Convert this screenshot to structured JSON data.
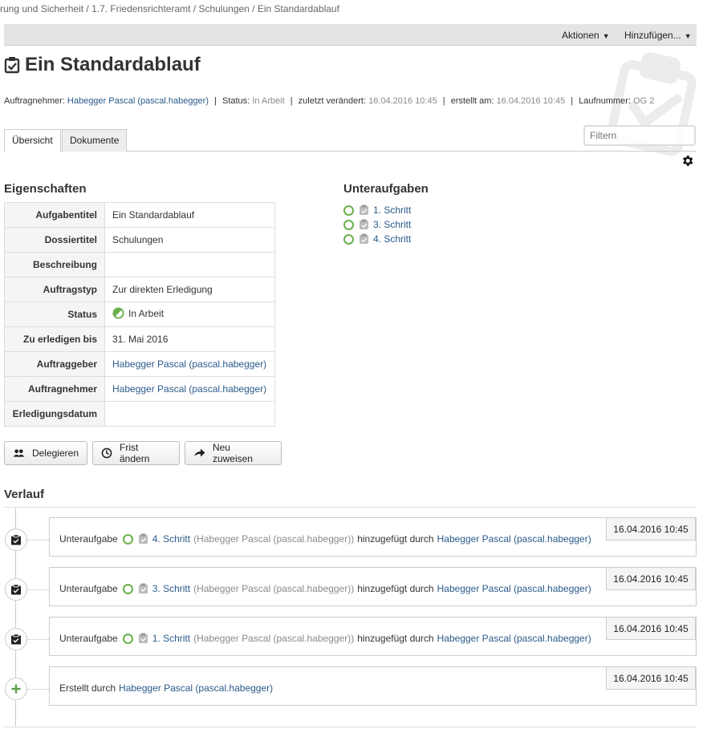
{
  "breadcrumb": "rung und Sicherheit / 1.7. Friedensrichteramt / Schulungen / Ein Standardablauf",
  "topbar": {
    "actions_label": "Aktionen",
    "add_label": "Hinzufügen..."
  },
  "title": "Ein Standardablauf",
  "meta": {
    "assignee_label": "Auftragnehmer:",
    "assignee": "Habegger Pascal (pascal.habegger)",
    "status_label": "Status:",
    "status": "In Arbeit",
    "modified_label": "zuletzt verändert:",
    "modified": "16.04.2016 10:45",
    "created_label": "erstellt am:",
    "created": "16.04.2016 10:45",
    "number_label": "Laufnummer:",
    "number": "OG 2"
  },
  "tabs": [
    {
      "label": "Übersicht",
      "active": true
    },
    {
      "label": "Dokumente",
      "active": false
    }
  ],
  "filter_placeholder": "Filtern",
  "properties": {
    "heading": "Eigenschaften",
    "rows": [
      {
        "key": "Aufgabentitel",
        "value": "Ein Standardablauf"
      },
      {
        "key": "Dossiertitel",
        "value": "Schulungen"
      },
      {
        "key": "Beschreibung",
        "value": ""
      },
      {
        "key": "Auftragstyp",
        "value": "Zur direkten Erledigung"
      },
      {
        "key": "Status",
        "value": "In Arbeit"
      },
      {
        "key": "Zu erledigen bis",
        "value": "31. Mai 2016"
      },
      {
        "key": "Auftraggeber",
        "value": "Habegger Pascal (pascal.habegger)"
      },
      {
        "key": "Auftragnehmer",
        "value": "Habegger Pascal (pascal.habegger)"
      },
      {
        "key": "Erledigungsdatum",
        "value": ""
      }
    ]
  },
  "subtasks": {
    "heading": "Unteraufgaben",
    "items": [
      "1. Schritt",
      "3. Schritt",
      "4. Schritt"
    ]
  },
  "buttons": {
    "delegate": "Delegieren",
    "deadline": "Frist ändern",
    "reassign": "Neu zuweisen"
  },
  "history": {
    "heading": "Verlauf",
    "entries": [
      {
        "prefix": "Unteraufgabe",
        "task": "4. Schritt",
        "assignee": "(Habegger Pascal (pascal.habegger))",
        "action": "hinzugefügt durch",
        "by": "Habegger Pascal (pascal.habegger)",
        "date": "16.04.2016 10:45"
      },
      {
        "prefix": "Unteraufgabe",
        "task": "3. Schritt",
        "assignee": "(Habegger Pascal (pascal.habegger))",
        "action": "hinzugefügt durch",
        "by": "Habegger Pascal (pascal.habegger)",
        "date": "16.04.2016 10:45"
      },
      {
        "prefix": "Unteraufgabe",
        "task": "1. Schritt",
        "assignee": "(Habegger Pascal (pascal.habegger))",
        "action": "hinzugefügt durch",
        "by": "Habegger Pascal (pascal.habegger)",
        "date": "16.04.2016 10:45"
      },
      {
        "prefix": "Erstellt durch",
        "by": "Habegger Pascal (pascal.habegger)",
        "date": "16.04.2016 10:45"
      }
    ]
  },
  "colors": {
    "link": "#2a5a8a",
    "status_green": "#6ab04c",
    "topbar": "#e4e4e4"
  },
  "icons": [
    "clipboard-check-icon",
    "gear-icon",
    "people-icon",
    "clock-icon",
    "arrow-right-icon",
    "task-icon",
    "plus-icon",
    "document-icon"
  ]
}
